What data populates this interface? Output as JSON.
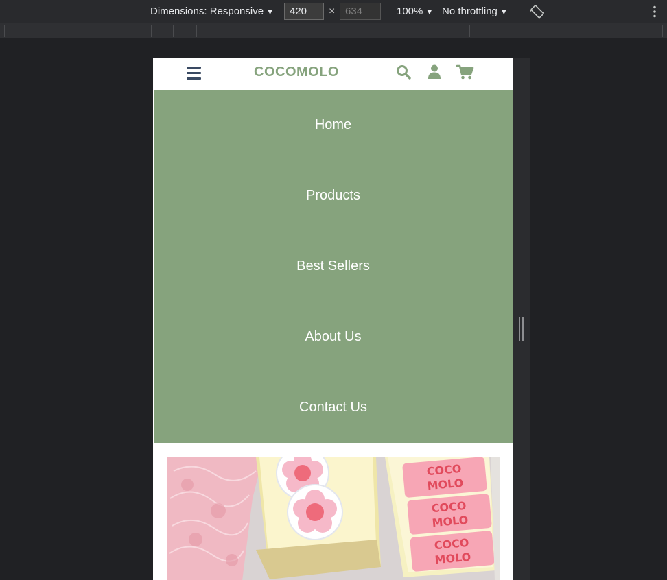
{
  "devtools": {
    "dimensions_label": "Dimensions: Responsive",
    "width_value": "420",
    "times_sign": "×",
    "height_placeholder": "634",
    "zoom_label": "100%",
    "throttle_label": "No throttling",
    "caret": "▼"
  },
  "site": {
    "brand": "COCOMOLO",
    "accent_color": "#86a37d",
    "hamburger_color": "#3a4a63",
    "header_icons": [
      "search-icon",
      "user-icon",
      "cart-icon"
    ],
    "nav": {
      "items": [
        {
          "label": "Home"
        },
        {
          "label": "Products"
        },
        {
          "label": "Best Sellers"
        },
        {
          "label": "About Us"
        },
        {
          "label": "Contact Us"
        }
      ]
    },
    "hero_image": {
      "stickers_text": [
        "COCO",
        "MOLO"
      ]
    }
  }
}
